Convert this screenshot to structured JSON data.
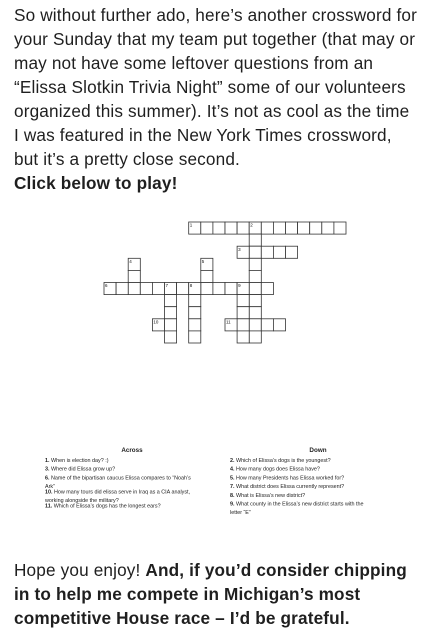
{
  "intro": {
    "text": "So without further ado, here’s another crossword for your Sunday that my team put together (that may or may not have some leftover questions from an “Elissa Slotkin Trivia Night” some of our volunteers organized this summer). It’s not as cool as the time I was featured in the New York Times crossword, but it’s a pretty close second.",
    "cta": "Click below to play!"
  },
  "crossword": {
    "across_title": "Across",
    "down_title": "Down",
    "across": [
      {
        "num": "1.",
        "text": "When is election day? :)"
      },
      {
        "num": "3.",
        "text": "Where did Elissa grow up?"
      },
      {
        "num": "6.",
        "text": "Name of the bipartisan caucus Elissa compares to “Noah’s"
      },
      {
        "num": "",
        "text": "Ark”"
      },
      {
        "num": "10.",
        "text": "How many tours did elissa serve in Iraq as a CIA analyst,"
      },
      {
        "num": "",
        "text": "working alongside the military?"
      },
      {
        "num": "11.",
        "text": "Which of Elissa’s dogs has the longest ears?"
      }
    ],
    "down": [
      {
        "num": "2.",
        "text": "Which of Elissa’s dogs is the youngest?"
      },
      {
        "num": "4.",
        "text": "How many dogs does Elissa have?"
      },
      {
        "num": "5.",
        "text": "How many Presidents has Elissa worked for?"
      },
      {
        "num": "7.",
        "text": "What district does Elissa currently represent?"
      },
      {
        "num": "8.",
        "text": "What is Elissa’s new district?"
      },
      {
        "num": "9.",
        "text": "What county in the Elissa’s new district starts with the"
      },
      {
        "num": "",
        "text": "letter “E”"
      }
    ],
    "cell_numbers": [
      "1",
      "2",
      "3",
      "4",
      "5",
      "6",
      "7",
      "8",
      "9",
      "10",
      "11"
    ]
  },
  "outro": {
    "normal": "Hope you enjoy! ",
    "bold": "And, if you’d consider chipping in to help me compete in Michigan’s most competitive House race – I’d be grateful."
  }
}
